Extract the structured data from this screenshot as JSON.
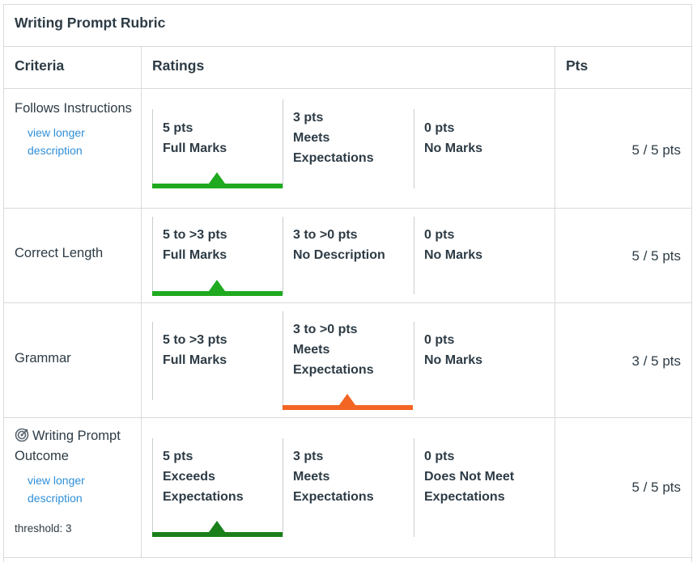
{
  "title": "Writing Prompt Rubric",
  "headers": {
    "criteria": "Criteria",
    "ratings": "Ratings",
    "pts": "Pts"
  },
  "colors": {
    "selected_green": "#1faa1f",
    "selected_dark_green": "#1a7f1a",
    "selected_orange": "#f26522",
    "link_blue": "#2f8fd8",
    "text": "#2d3b45",
    "border": "#d7dadd"
  },
  "criteria": [
    {
      "name": "Follows Instructions",
      "link": "view longer description",
      "ratings": [
        {
          "points": "5 pts",
          "description": "Full Marks",
          "selected": true
        },
        {
          "points": "3 pts",
          "description": "Meets Expectations",
          "selected": false
        },
        {
          "points": "0 pts",
          "description": "No Marks",
          "selected": false
        }
      ],
      "score": "5 / 5 pts"
    },
    {
      "name": "Correct Length",
      "ratings": [
        {
          "points": "5 to >3 pts",
          "description": "Full Marks",
          "selected": true
        },
        {
          "points": "3 to >0 pts",
          "description": "No Description",
          "selected": false
        },
        {
          "points": "0 pts",
          "description": "No Marks",
          "selected": false
        }
      ],
      "score": "5 / 5 pts"
    },
    {
      "name": "Grammar",
      "ratings": [
        {
          "points": "5 to >3 pts",
          "description": "Full Marks",
          "selected": false
        },
        {
          "points": "3 to >0 pts",
          "description": "Meets Expectations",
          "selected": true
        },
        {
          "points": "0 pts",
          "description": "No Marks",
          "selected": false
        }
      ],
      "score": "3 / 5 pts"
    },
    {
      "name": "Writing Prompt Outcome",
      "icon": "outcome-target-icon",
      "link": "view longer description",
      "threshold": "threshold: 3",
      "ratings": [
        {
          "points": "5 pts",
          "description": "Exceeds Expectations",
          "selected": true
        },
        {
          "points": "3 pts",
          "description": "Meets Expectations",
          "selected": false
        },
        {
          "points": "0 pts",
          "description": "Does Not Meet Expectations",
          "selected": false
        }
      ],
      "score": "5 / 5 pts"
    }
  ]
}
